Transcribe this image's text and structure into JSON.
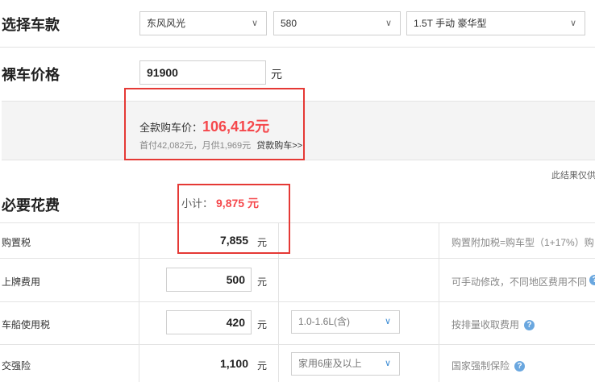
{
  "select_car": {
    "title": "选择车款",
    "brand": "东风风光",
    "series": "580",
    "model": "1.5T 手动 豪华型"
  },
  "bare_price": {
    "title": "裸车价格",
    "value": "91900",
    "unit": "元"
  },
  "full_price": {
    "label": "全款购车价：",
    "value": "106,412元",
    "loan_summary": "首付42,082元，月供1,969元",
    "loan_link": "贷款购车>>"
  },
  "disclaimer": "此结果仅供",
  "required_costs": {
    "title": "必要花费",
    "subtotal_label": "小计：",
    "subtotal_value": "9,875 元",
    "rows": [
      {
        "label": "购置税",
        "value": "7,855",
        "unit": "元",
        "note": "购置附加税=购车型（1+17%）购"
      },
      {
        "label": "上牌费用",
        "value": "500",
        "unit": "元",
        "note": "可手动修改，不同地区费用不同"
      },
      {
        "label": "车船使用税",
        "value": "420",
        "unit": "元",
        "option": "1.0-1.6L(含)",
        "note": "按排量收取费用"
      },
      {
        "label": "交强险",
        "value": "1,100",
        "unit": "元",
        "option": "家用6座及以上",
        "note": "国家强制保险"
      }
    ]
  },
  "colors": {
    "accent_red": "#e53935",
    "price_red": "#f5484c",
    "help_blue": "#6aa7df"
  }
}
